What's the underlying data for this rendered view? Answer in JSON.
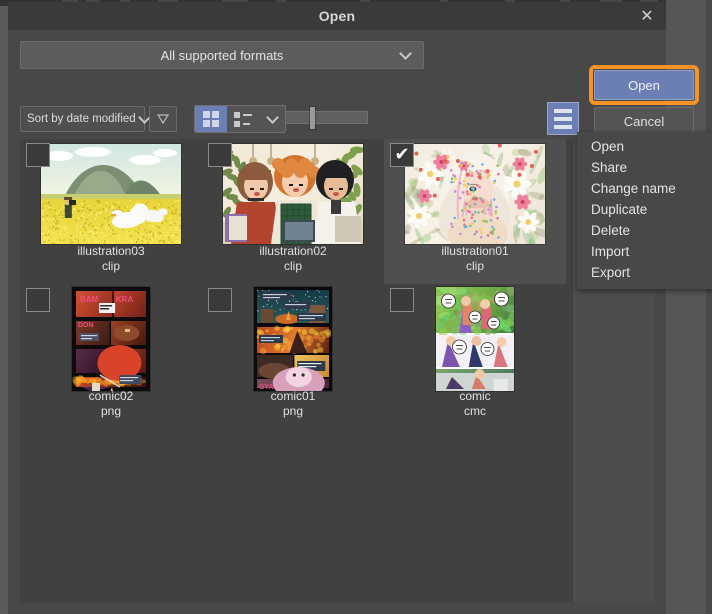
{
  "window": {
    "title": "Open",
    "close_icon": "close-icon",
    "close_glyph": "✕"
  },
  "toolbar": {
    "format_filter": "All supported formats",
    "format_chevron_icon": "chevron-down-icon",
    "sort_by": "Sort by date modified",
    "sort_chevron_icon": "chevron-down-icon",
    "sort_direction_icon": "triangle-down-icon",
    "view_grid_icon": "grid-view-icon",
    "view_list_icon": "list-view-icon",
    "view_chevron_icon": "chevron-down-icon",
    "zoom_slider_icon": "thumbnail-size-slider",
    "zoom_slider_value": 30,
    "menu_toggle_icon": "hamburger-menu-icon"
  },
  "actions": {
    "open_label": "Open",
    "cancel_label": "Cancel",
    "highlight_color": "#f79326",
    "accent_color": "#6b7fb5"
  },
  "context_menu": {
    "items": [
      {
        "label": "Open"
      },
      {
        "label": "Share"
      },
      {
        "label": "Change name"
      },
      {
        "label": "Duplicate"
      },
      {
        "label": "Delete"
      },
      {
        "label": "Import"
      },
      {
        "label": "Export"
      }
    ]
  },
  "files": [
    {
      "name": "illustration03",
      "ext": "clip",
      "selected": false,
      "checked": false,
      "orientation": "landscape",
      "thumb_kind": "field-landscape-with-geese"
    },
    {
      "name": "illustration02",
      "ext": "clip",
      "selected": false,
      "checked": false,
      "orientation": "landscape",
      "thumb_kind": "three-characters-cafe"
    },
    {
      "name": "illustration01",
      "ext": "clip",
      "selected": true,
      "checked": true,
      "orientation": "landscape",
      "thumb_kind": "white-haired-girl-flowers"
    },
    {
      "name": "comic02",
      "ext": "png",
      "selected": false,
      "checked": false,
      "orientation": "portrait",
      "thumb_kind": "comic-page-fire-red"
    },
    {
      "name": "comic01",
      "ext": "png",
      "selected": false,
      "checked": false,
      "orientation": "portrait",
      "thumb_kind": "comic-page-night-orange"
    },
    {
      "name": "comic",
      "ext": "cmc",
      "selected": false,
      "checked": false,
      "orientation": "portrait",
      "thumb_kind": "comic-page-green-stack"
    }
  ],
  "checkbox": {
    "tick_glyph": "✔"
  }
}
